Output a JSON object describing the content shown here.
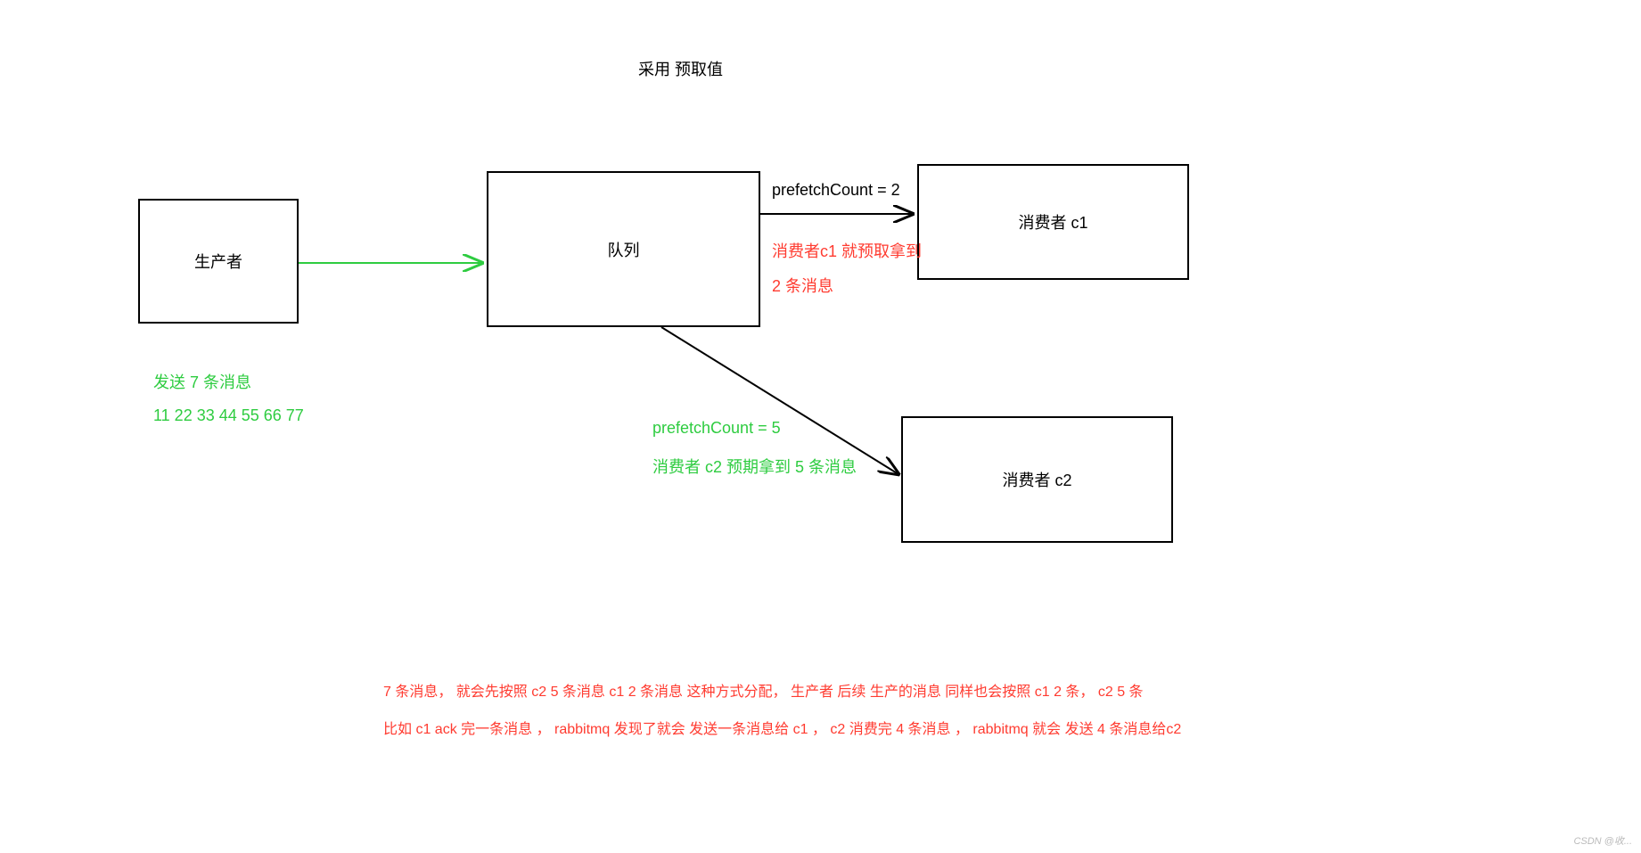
{
  "title": "采用 预取值",
  "boxes": {
    "producer": "生产者",
    "queue": "队列",
    "consumer1": "消费者 c1",
    "consumer2": "消费者 c2"
  },
  "arrow_c1": {
    "top_label": "prefetchCount = 2",
    "bottom_label_line1": "消费者c1 就预取拿到",
    "bottom_label_line2": "2 条消息"
  },
  "arrow_c2": {
    "label_line1": "prefetchCount = 5",
    "label_line2": "消费者 c2 预期拿到 5 条消息"
  },
  "producer_notes": {
    "line1": "发送 7 条消息",
    "line2": "11 22 33 44 55 66 77"
  },
  "footer": {
    "line1": "7 条消息， 就会先按照 c2 5 条消息 c1 2 条消息 这种方式分配， 生产者 后续 生产的消息 同样也会按照 c1 2 条，  c2 5 条",
    "line2": "比如 c1 ack 完一条消息 ， rabbitmq 发现了就会 发送一条消息给 c1 ，  c2 消费完 4 条消息 ， rabbitmq 就会 发送 4 条消息给c2"
  },
  "watermark": "CSDN @收...",
  "colors": {
    "green": "#2ecc40",
    "red": "#ff3b30",
    "black": "#000000"
  }
}
